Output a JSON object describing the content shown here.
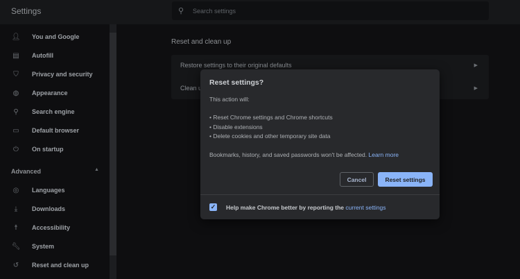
{
  "header": {
    "title": "Settings",
    "search_placeholder": "Search settings"
  },
  "sidebar": {
    "items": [
      {
        "label": "You and Google",
        "icon": "person-icon"
      },
      {
        "label": "Autofill",
        "icon": "clipboard-icon"
      },
      {
        "label": "Privacy and security",
        "icon": "shield-icon"
      },
      {
        "label": "Appearance",
        "icon": "palette-icon"
      },
      {
        "label": "Search engine",
        "icon": "search-icon"
      },
      {
        "label": "Default browser",
        "icon": "browser-icon"
      },
      {
        "label": "On startup",
        "icon": "power-icon"
      }
    ],
    "advanced_label": "Advanced",
    "advanced_items": [
      {
        "label": "Languages",
        "icon": "globe-icon"
      },
      {
        "label": "Downloads",
        "icon": "download-icon"
      },
      {
        "label": "Accessibility",
        "icon": "accessibility-icon"
      },
      {
        "label": "System",
        "icon": "wrench-icon"
      },
      {
        "label": "Reset and clean up",
        "icon": "history-icon"
      }
    ]
  },
  "main": {
    "section_title": "Reset and clean up",
    "rows": [
      "Restore settings to their original defaults",
      "Clean up computer"
    ]
  },
  "dialog": {
    "title": "Reset settings?",
    "intro": "This action will:",
    "bullets": [
      "• Reset Chrome settings and Chrome shortcuts",
      "• Disable extensions",
      "• Delete cookies and other temporary site data"
    ],
    "note": "Bookmarks, history, and saved passwords won't be affected.",
    "learn_more": "Learn more",
    "cancel": "Cancel",
    "confirm": "Reset settings",
    "checkbox_label": "Help make Chrome better by reporting the",
    "checkbox_link": "current settings",
    "checkbox_checked": true
  }
}
